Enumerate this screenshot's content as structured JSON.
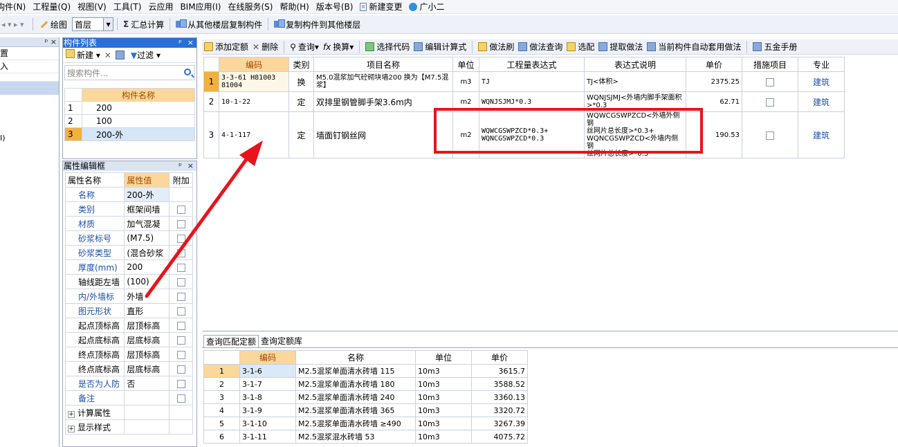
{
  "menu": {
    "items": [
      "构件(N)",
      "工程量(Q)",
      "视图(V)",
      "工具(T)",
      "云应用",
      "BIM应用(I)",
      "在线服务(S)",
      "帮助(H)",
      "版本号(B)",
      "新建变更",
      "广小二"
    ]
  },
  "toolbar": {
    "draw_label": "绘图",
    "floor_value": "首层",
    "sum_label": "汇总计算",
    "copy_from_label": "从其他楼层复制构件",
    "copy_to_label": "复制构件到其他楼层"
  },
  "left_panel": {
    "pin": "ᵖ ×",
    "rows": [
      "置",
      "入"
    ],
    "extra_text": "I)"
  },
  "component_list": {
    "title": "构件列表",
    "new_label": "新建",
    "filter_label": "过滤",
    "search_placeholder": "搜索构件...",
    "header": "构件名称",
    "rows": [
      {
        "num": "1",
        "name": "200"
      },
      {
        "num": "2",
        "name": "100"
      },
      {
        "num": "3",
        "name": "200-外"
      }
    ]
  },
  "property_editor": {
    "title": "属性编辑框",
    "headers": {
      "name": "属性名称",
      "value": "属性值",
      "extra": "附加"
    },
    "rows": [
      {
        "name": "名称",
        "value": "200-外"
      },
      {
        "name": "类别",
        "value": "框架间墙"
      },
      {
        "name": "材质",
        "value": "加气混凝"
      },
      {
        "name": "砂浆标号",
        "value": "(M7.5)"
      },
      {
        "name": "砂浆类型",
        "value": "(混合砂浆"
      },
      {
        "name": "厚度(mm)",
        "value": "200"
      },
      {
        "name": "轴线距左墙",
        "value": "(100)"
      },
      {
        "name": "内/外墙标",
        "value": "外墙"
      },
      {
        "name": "图元形状",
        "value": "直形"
      },
      {
        "name": "起点顶标高",
        "value": "层顶标高"
      },
      {
        "name": "起点底标高",
        "value": "层底标高"
      },
      {
        "name": "终点顶标高",
        "value": "层顶标高"
      },
      {
        "name": "终点底标高",
        "value": "层底标高"
      },
      {
        "name": "是否为人防",
        "value": "否"
      },
      {
        "name": "备注",
        "value": ""
      }
    ],
    "groups": [
      "计算属性",
      "显示样式"
    ]
  },
  "main_toolbar": {
    "add_quota": "添加定额",
    "delete": "删除",
    "query": "查询",
    "convert": "换算",
    "select_code": "选择代码",
    "edit_formula": "编辑计算式",
    "method_brush": "做法刷",
    "method_query": "做法查询",
    "select_match": "选配",
    "extract_method": "提取做法",
    "auto_apply": "当前构件自动套用做法",
    "hardware_manual": "五金手册"
  },
  "quota_table": {
    "headers": {
      "code": "编码",
      "type": "类别",
      "name": "项目名称",
      "unit": "单位",
      "expr": "工程量表达式",
      "desc": "表达式说明",
      "price": "单价",
      "measure": "措施项目",
      "major": "专业"
    },
    "rows": [
      {
        "num": "1",
        "code": "3-3-61 H81003 81004",
        "type": "换",
        "name": "M5.0混浆加气砼砌块墙200 换为【M7.5混浆】",
        "unit": "m3",
        "expr": "TJ",
        "desc": "TJ<体积>",
        "price": "2375.25",
        "major": "建筑"
      },
      {
        "num": "2",
        "code": "10-1-22",
        "type": "定",
        "name": "双排里钢管脚手架3.6m内",
        "unit": "m2",
        "expr": "WQNJSJMJ*0.3",
        "desc": "WQNJSJMJ<外墙内脚手架面积>*0.3",
        "price": "62.71",
        "major": "建筑"
      },
      {
        "num": "3",
        "code": "4-1-117",
        "type": "定",
        "name": "墙面钉钢丝网",
        "unit": "m2",
        "expr_line1": "WQWCGSWPZCD*0.3+",
        "expr_line2": "WQNCGSWPZCD*0.3",
        "desc_line1": "WQWCGSWPZCD<外墙外侧钢",
        "desc_line2": "丝网片总长度>*0.3+",
        "desc_line3": "WQNCGSWPZCD<外墙内侧钢",
        "desc_line4": "丝网片总长度>*0.3",
        "price": "190.53",
        "major": "建筑"
      }
    ]
  },
  "bottom_panel": {
    "tabs": [
      "查询匹配定额",
      "查询定额库"
    ],
    "headers": {
      "code": "编码",
      "name": "名称",
      "unit": "单位",
      "price": "单价"
    },
    "rows": [
      {
        "num": "1",
        "code": "3-1-6",
        "name": "M2.5混浆单面清水砖墙 115",
        "unit": "10m3",
        "price": "3615.7"
      },
      {
        "num": "2",
        "code": "3-1-7",
        "name": "M2.5混浆单面清水砖墙 180",
        "unit": "10m3",
        "price": "3588.52"
      },
      {
        "num": "3",
        "code": "3-1-8",
        "name": "M2.5混浆单面清水砖墙 240",
        "unit": "10m3",
        "price": "3360.13"
      },
      {
        "num": "4",
        "code": "3-1-9",
        "name": "M2.5混浆单面清水砖墙 365",
        "unit": "10m3",
        "price": "3320.72"
      },
      {
        "num": "5",
        "code": "3-1-10",
        "name": "M2.5混浆单面清水砖墙 ≥490",
        "unit": "10m3",
        "price": "3267.39"
      },
      {
        "num": "6",
        "code": "3-1-11",
        "name": "M2.5混浆混水砖墙 53",
        "unit": "10m3",
        "price": "4075.72"
      }
    ]
  },
  "colors": {
    "accent_blue": "#2a6fd6",
    "header_orange": "#fbd79b",
    "annotation_red": "#e8141c"
  }
}
